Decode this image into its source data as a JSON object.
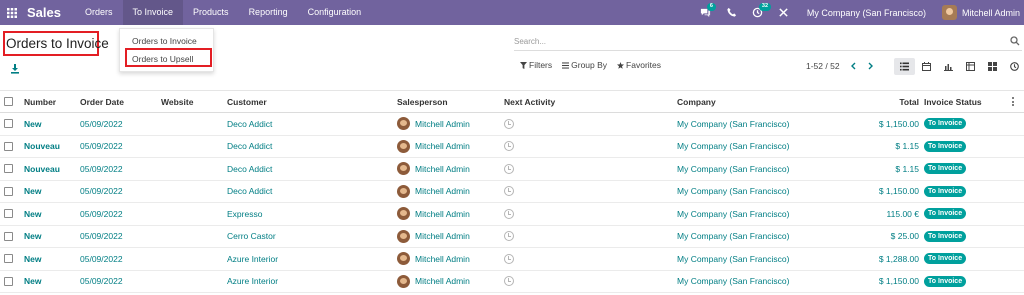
{
  "navbar": {
    "brand": "Sales",
    "menus": [
      "Orders",
      "To Invoice",
      "Products",
      "Reporting",
      "Configuration"
    ],
    "chat_badge": "6",
    "activity_badge": "32",
    "company": "My Company (San Francisco)",
    "user": "Mitchell Admin",
    "bg_color": "#71639e"
  },
  "page": {
    "title": "Orders to Invoice"
  },
  "dropdown": {
    "items": [
      "Orders to Invoice",
      "Orders to Upsell"
    ]
  },
  "search": {
    "placeholder": "Search..."
  },
  "toolbar": {
    "filters": "Filters",
    "group_by": "Group By",
    "favorites": "Favorites",
    "pager": "1-52 / 52"
  },
  "table": {
    "columns": {
      "number": "Number",
      "order_date": "Order Date",
      "website": "Website",
      "customer": "Customer",
      "salesperson": "Salesperson",
      "next_activity": "Next Activity",
      "company": "Company",
      "total": "Total",
      "invoice_status": "Invoice Status"
    },
    "rows": [
      {
        "number": "New",
        "date": "05/09/2022",
        "customer": "Deco Addict",
        "salesperson": "Mitchell Admin",
        "company": "My Company (San Francisco)",
        "total": "$ 1,150.00",
        "status": "To Invoice"
      },
      {
        "number": "Nouveau",
        "date": "05/09/2022",
        "customer": "Deco Addict",
        "salesperson": "Mitchell Admin",
        "company": "My Company (San Francisco)",
        "total": "$ 1.15",
        "status": "To Invoice"
      },
      {
        "number": "Nouveau",
        "date": "05/09/2022",
        "customer": "Deco Addict",
        "salesperson": "Mitchell Admin",
        "company": "My Company (San Francisco)",
        "total": "$ 1.15",
        "status": "To Invoice"
      },
      {
        "number": "New",
        "date": "05/09/2022",
        "customer": "Deco Addict",
        "salesperson": "Mitchell Admin",
        "company": "My Company (San Francisco)",
        "total": "$ 1,150.00",
        "status": "To Invoice"
      },
      {
        "number": "New",
        "date": "05/09/2022",
        "customer": "Expresso",
        "salesperson": "Mitchell Admin",
        "company": "My Company (San Francisco)",
        "total": "115.00 €",
        "status": "To Invoice"
      },
      {
        "number": "New",
        "date": "05/09/2022",
        "customer": "Cerro Castor",
        "salesperson": "Mitchell Admin",
        "company": "My Company (San Francisco)",
        "total": "$ 25.00",
        "status": "To Invoice"
      },
      {
        "number": "New",
        "date": "05/09/2022",
        "customer": "Azure Interior",
        "salesperson": "Mitchell Admin",
        "company": "My Company (San Francisco)",
        "total": "$ 1,288.00",
        "status": "To Invoice"
      },
      {
        "number": "New",
        "date": "05/09/2022",
        "customer": "Azure Interior",
        "salesperson": "Mitchell Admin",
        "company": "My Company (San Francisco)",
        "total": "$ 1,150.00",
        "status": "To Invoice"
      }
    ]
  },
  "colors": {
    "link": "#017e84",
    "status_badge": "#00a09d",
    "highlight_box": "#e31e24"
  }
}
